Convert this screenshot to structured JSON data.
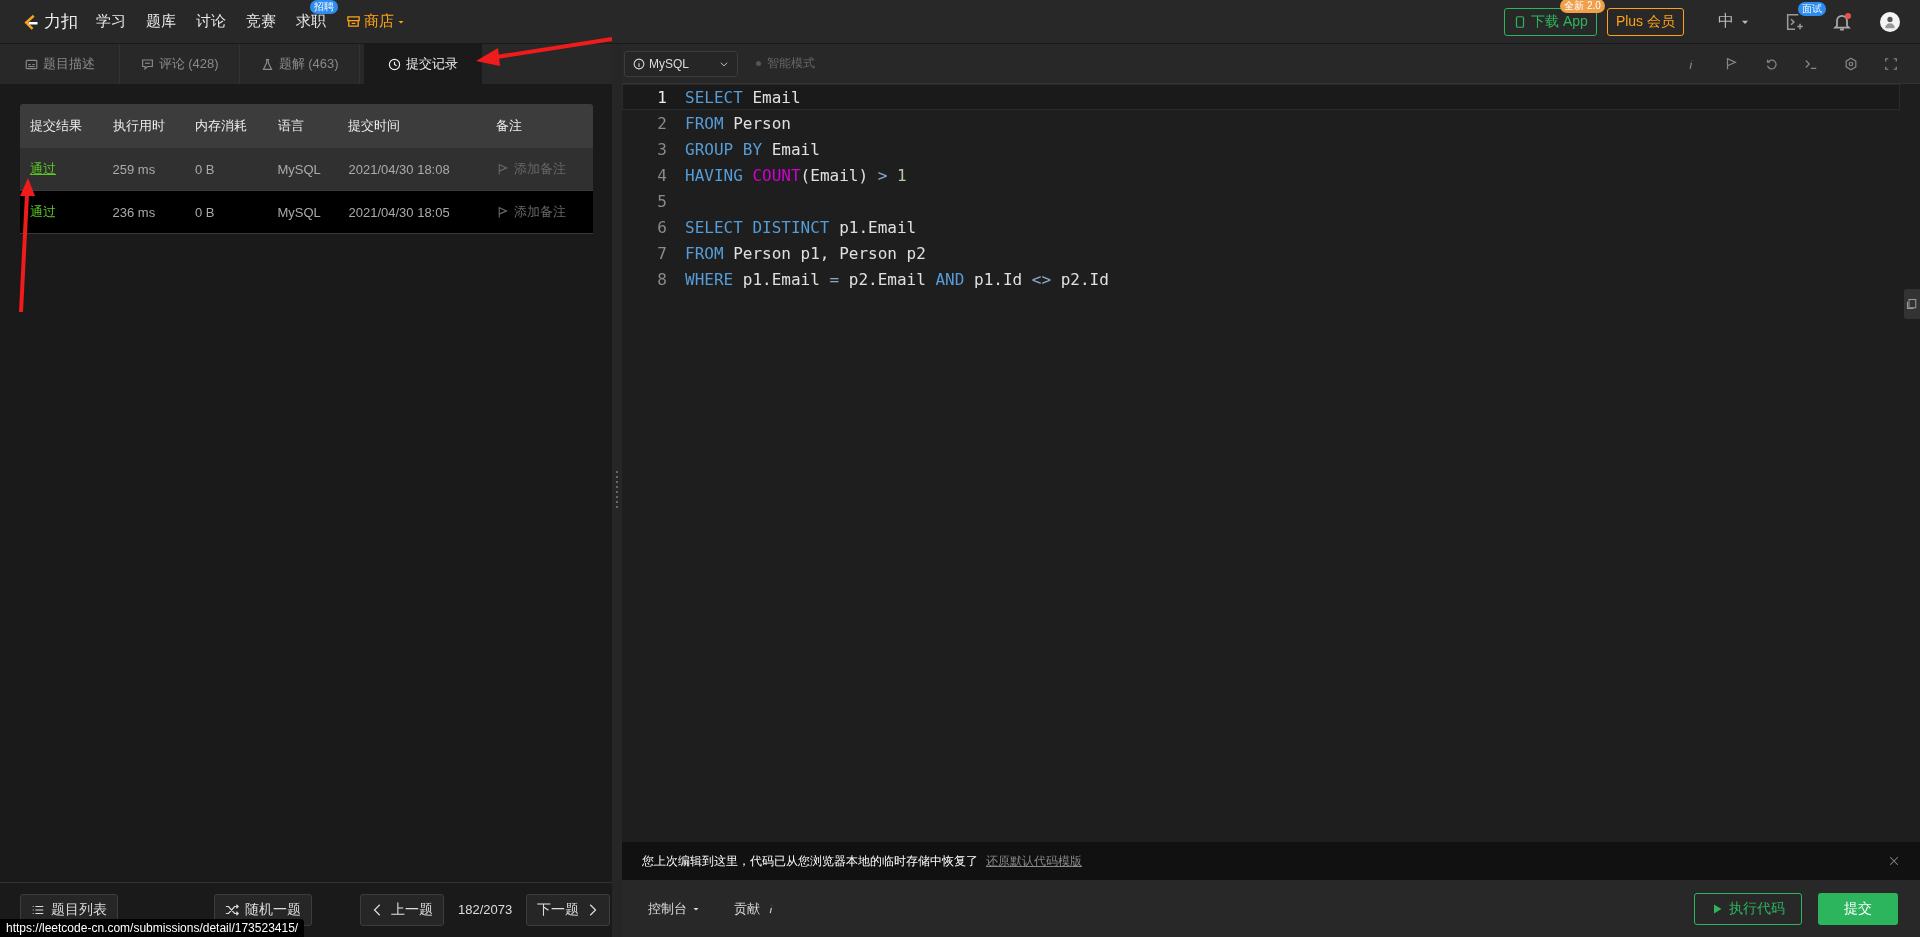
{
  "nav": {
    "logo": "力扣",
    "items": [
      {
        "label": "学习",
        "kind": "plain"
      },
      {
        "label": "题库",
        "kind": "plain"
      },
      {
        "label": "讨论",
        "kind": "plain"
      },
      {
        "label": "竞赛",
        "kind": "plain"
      },
      {
        "label": "求职",
        "kind": "plain",
        "badge": "招聘"
      },
      {
        "label": "商店",
        "kind": "store"
      }
    ],
    "download": {
      "label": "下载 App",
      "badge": "全新 2.0"
    },
    "plus": "Plus 会员",
    "language": "中",
    "interview_badge": "面试",
    "notifications_unread": true
  },
  "tabs": [
    {
      "label": "题目描述",
      "kind": "description",
      "selected": false
    },
    {
      "label": "评论",
      "count": "(428)",
      "kind": "comment",
      "selected": false
    },
    {
      "label": "题解",
      "count": "(463)",
      "kind": "solution",
      "selected": false
    },
    {
      "label": "提交记录",
      "kind": "history",
      "selected": true
    }
  ],
  "table": {
    "columns": [
      "提交结果",
      "执行用时",
      "内存消耗",
      "语言",
      "提交时间",
      "备注"
    ],
    "rows": [
      {
        "result": "通过",
        "time": "259 ms",
        "memory": "0 B",
        "language": "MySQL",
        "submitted": "2021/04/30 18:08",
        "note": "添加备注",
        "selected": true
      },
      {
        "result": "通过",
        "time": "236 ms",
        "memory": "0 B",
        "language": "MySQL",
        "submitted": "2021/04/30 18:05",
        "note": "添加备注",
        "selected": false
      }
    ]
  },
  "editor": {
    "language": "MySQL",
    "mode": {
      "label": "智能模式",
      "on": false
    },
    "lines": [
      {
        "number": "1",
        "active": true,
        "tokens": [
          {
            "kind": "keyword",
            "text": "SELECT"
          },
          {
            "kind": "plain",
            "text": " Email"
          }
        ]
      },
      {
        "number": "2",
        "active": false,
        "tokens": [
          {
            "kind": "keyword",
            "text": "FROM"
          },
          {
            "kind": "plain",
            "text": " Person"
          }
        ]
      },
      {
        "number": "3",
        "active": false,
        "tokens": [
          {
            "kind": "keyword",
            "text": "GROUP BY"
          },
          {
            "kind": "plain",
            "text": " Email"
          }
        ]
      },
      {
        "number": "4",
        "active": false,
        "tokens": [
          {
            "kind": "keyword",
            "text": "HAVING "
          },
          {
            "kind": "function",
            "text": "COUNT"
          },
          {
            "kind": "plain",
            "text": "(Email) "
          },
          {
            "kind": "operator",
            "text": "> "
          },
          {
            "kind": "number",
            "text": "1"
          }
        ]
      },
      {
        "number": "5",
        "active": false
      },
      {
        "number": "6",
        "active": false,
        "tokens": [
          {
            "kind": "keyword",
            "text": "SELECT DISTINCT"
          },
          {
            "kind": "plain",
            "text": " p1.Email"
          }
        ]
      },
      {
        "number": "7",
        "active": false,
        "tokens": [
          {
            "kind": "keyword",
            "text": "FROM"
          },
          {
            "kind": "plain",
            "text": " Person p1, Person p2"
          }
        ]
      },
      {
        "number": "8",
        "active": false,
        "tokens": [
          {
            "kind": "keyword",
            "text": "WHERE"
          },
          {
            "kind": "plain",
            "text": " p1.Email "
          },
          {
            "kind": "operator",
            "text": "="
          },
          {
            "kind": "plain",
            "text": " p2.Email "
          },
          {
            "kind": "keyword",
            "text": "AND"
          },
          {
            "kind": "plain",
            "text": " p1.Id "
          },
          {
            "kind": "operator",
            "text": "<>"
          },
          {
            "kind": "plain",
            "text": " p2.Id"
          }
        ]
      }
    ]
  },
  "notice": {
    "text": "您上次编辑到这里，代码已从您浏览器本地的临时存储中恢复了",
    "link": "还原默认代码模版"
  },
  "footer_left": {
    "problem_list": "题目列表",
    "random": "随机一题",
    "prev": "上一题",
    "progress": "182/2073",
    "next": "下一题"
  },
  "footer_right": {
    "console": "控制台",
    "contribute": "贡献",
    "run": "执行代码",
    "submit": "提交"
  },
  "status_url": "https://leetcode-cn.com/submissions/detail/173523415/"
}
